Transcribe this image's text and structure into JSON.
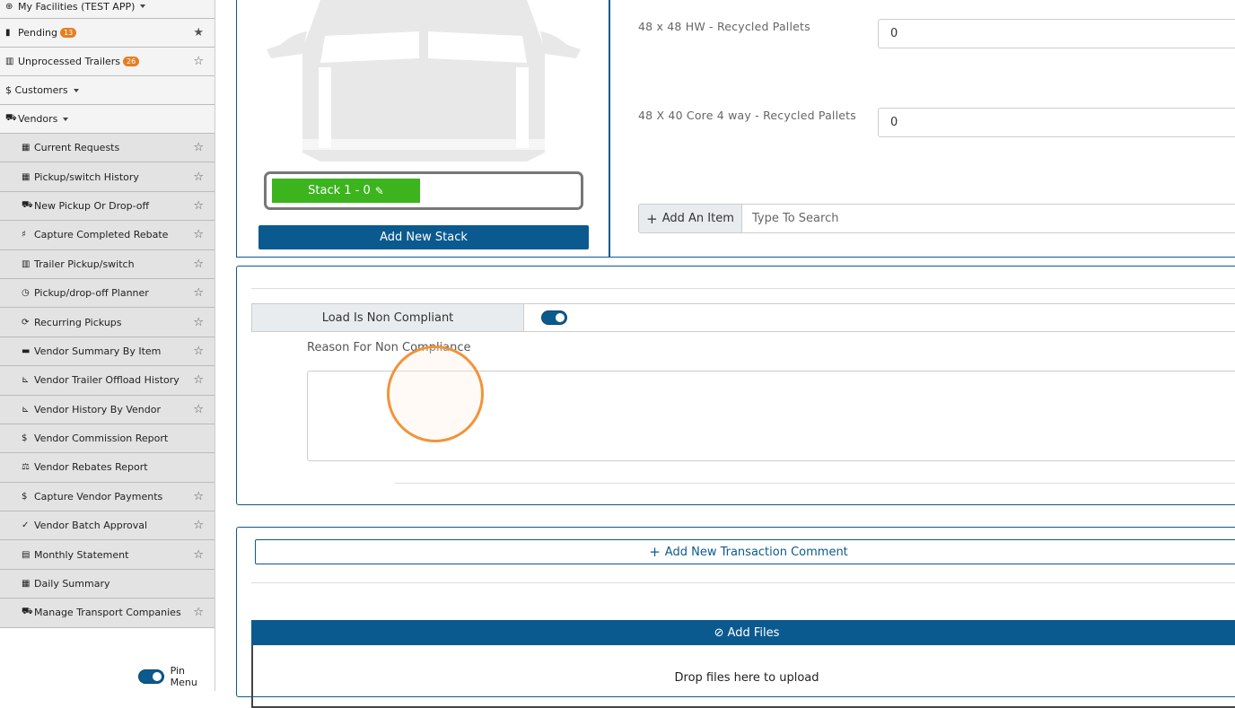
{
  "sidebar": {
    "top_items": [
      {
        "label": "My Facilities (TEST APP)",
        "icon": "globe-icon",
        "caret": true
      },
      {
        "label": "Pending",
        "icon": "clipboard-icon",
        "badge": "13",
        "star": "filled"
      },
      {
        "label": "Unprocessed Trailers",
        "icon": "trailer-icon",
        "badge": "26",
        "star": "outline"
      },
      {
        "label": "$ Customers",
        "icon": "",
        "caret": true
      },
      {
        "label": "Vendors",
        "icon": "truck-icon",
        "caret": true
      }
    ],
    "vendor_items": [
      {
        "label": "Current Requests",
        "icon": "table-icon",
        "glyph": "▦",
        "star": true
      },
      {
        "label": "Pickup/switch History",
        "icon": "table-icon",
        "glyph": "▦",
        "star": true
      },
      {
        "label": "New Pickup Or Drop-off",
        "icon": "dolly-icon",
        "glyph": "⛟",
        "star": true
      },
      {
        "label": "Capture Completed Rebate",
        "icon": "pallet-icon",
        "glyph": "♯",
        "star": true
      },
      {
        "label": "Trailer Pickup/switch",
        "icon": "trailer-icon",
        "glyph": "▥",
        "star": true
      },
      {
        "label": "Pickup/drop-off Planner",
        "icon": "clock-icon",
        "glyph": "◷",
        "star": true
      },
      {
        "label": "Recurring Pickups",
        "icon": "repeat-icon",
        "glyph": "⟳",
        "star": true
      },
      {
        "label": "Vendor Summary By Item",
        "icon": "pallet-icon",
        "glyph": "▬",
        "star": true
      },
      {
        "label": "Vendor Trailer Offload History",
        "icon": "chart-icon",
        "glyph": "⊾",
        "star": true
      },
      {
        "label": "Vendor History By Vendor",
        "icon": "chart-icon",
        "glyph": "⊾",
        "star": true
      },
      {
        "label": "Vendor Commission Report",
        "icon": "dollar-icon",
        "glyph": "$",
        "star": false
      },
      {
        "label": "Vendor Rebates Report",
        "icon": "scale-icon",
        "glyph": "⚖",
        "star": false
      },
      {
        "label": "Capture Vendor Payments",
        "icon": "dollar-icon",
        "glyph": "$",
        "star": true
      },
      {
        "label": "Vendor Batch Approval",
        "icon": "check-icon",
        "glyph": "✓",
        "star": true
      },
      {
        "label": "Monthly Statement",
        "icon": "calendar-icon",
        "glyph": "▤",
        "star": true
      },
      {
        "label": "Daily Summary",
        "icon": "table-icon",
        "glyph": "▦",
        "star": false
      },
      {
        "label": "Manage Transport Companies",
        "icon": "truck-icon",
        "glyph": "⛟",
        "star": true
      }
    ],
    "pin_menu_label": "Pin Menu"
  },
  "stack": {
    "stack_label": "Stack 1 - 0",
    "add_stack_label": "Add New Stack"
  },
  "items": [
    {
      "label": "48 x 48 HW - Recycled Pallets",
      "value": "0"
    },
    {
      "label": "48 X 40 Core 4 way - Recycled Pallets",
      "value": "0"
    }
  ],
  "add_item": {
    "button_label": "Add An Item",
    "search_placeholder": "Type To Search"
  },
  "compliance": {
    "label": "Load Is Non Compliant",
    "toggle_on": true,
    "reason_label": "Reason For Non Compliance"
  },
  "comments": {
    "add_label": "Add New Transaction Comment"
  },
  "files": {
    "add_label": "Add Files",
    "drop_label": "Drop files here to upload"
  },
  "colors": {
    "primary": "#0b5a8f",
    "success": "#3cb41e",
    "badge": "#e67e22",
    "cursor": "#f0943a"
  }
}
